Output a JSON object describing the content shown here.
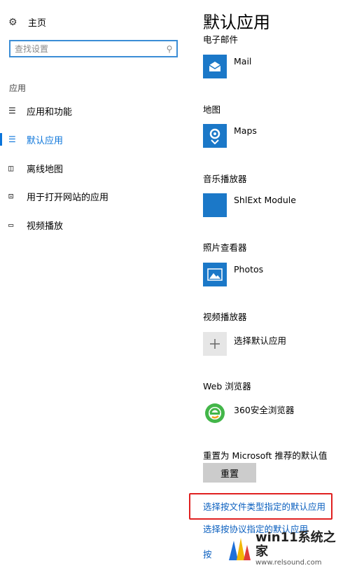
{
  "sidebar": {
    "home_label": "主页",
    "search_placeholder": "查找设置",
    "section_title": "应用",
    "items": [
      {
        "label": "应用和功能",
        "icon": "apps-features-icon"
      },
      {
        "label": "默认应用",
        "icon": "default-apps-icon"
      },
      {
        "label": "离线地图",
        "icon": "offline-maps-icon"
      },
      {
        "label": "用于打开网站的应用",
        "icon": "apps-for-websites-icon"
      },
      {
        "label": "视频播放",
        "icon": "video-playback-icon"
      }
    ]
  },
  "main": {
    "title": "默认应用",
    "categories": [
      {
        "label": "电子邮件",
        "app": "Mail",
        "icon": "mail-icon"
      },
      {
        "label": "地图",
        "app": "Maps",
        "icon": "maps-icon"
      },
      {
        "label": "音乐播放器",
        "app": "ShlExt Module",
        "icon": "blank-app-icon"
      },
      {
        "label": "照片查看器",
        "app": "Photos",
        "icon": "photos-icon"
      },
      {
        "label": "视频播放器",
        "app": "选择默认应用",
        "icon": "plus-icon"
      },
      {
        "label": "Web 浏览器",
        "app": "360安全浏览器",
        "icon": "browser-360-icon"
      }
    ],
    "reset_text": "重置为 Microsoft 推荐的默认值",
    "reset_button": "重置",
    "links": [
      "选择按文件类型指定的默认应用",
      "选择按协议指定的默认应用",
      "按"
    ]
  },
  "watermark": {
    "main": "win11系统之家",
    "sub": "www.relsound.com"
  },
  "colors": {
    "accent": "#0a74da",
    "tile": "#1b78c8",
    "highlight": "#e02020"
  }
}
